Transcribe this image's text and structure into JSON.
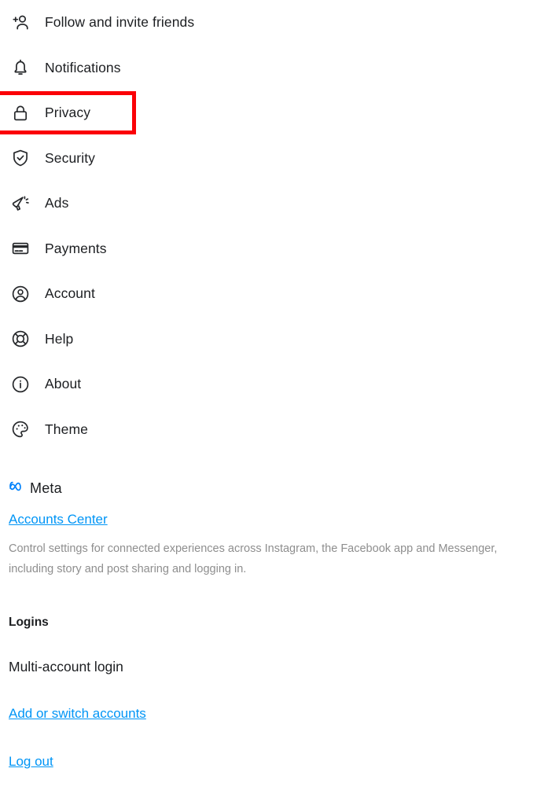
{
  "menu": {
    "items": [
      {
        "label": "Follow and invite friends",
        "icon": "person-add-icon",
        "highlighted": false
      },
      {
        "label": "Notifications",
        "icon": "bell-icon",
        "highlighted": false
      },
      {
        "label": "Privacy",
        "icon": "lock-icon",
        "highlighted": true
      },
      {
        "label": "Security",
        "icon": "shield-check-icon",
        "highlighted": false
      },
      {
        "label": "Ads",
        "icon": "megaphone-icon",
        "highlighted": false
      },
      {
        "label": "Payments",
        "icon": "credit-card-icon",
        "highlighted": false
      },
      {
        "label": "Account",
        "icon": "user-circle-icon",
        "highlighted": false
      },
      {
        "label": "Help",
        "icon": "lifebuoy-icon",
        "highlighted": false
      },
      {
        "label": "About",
        "icon": "info-circle-icon",
        "highlighted": false
      },
      {
        "label": "Theme",
        "icon": "palette-icon",
        "highlighted": false
      }
    ]
  },
  "meta_section": {
    "logo_icon": "meta-infinity-icon",
    "brand": "Meta",
    "accounts_center_label": "Accounts Center",
    "description": "Control settings for connected experiences across Instagram, the Facebook app and Messenger, including story and post sharing and logging in."
  },
  "logins_section": {
    "heading": "Logins",
    "multi_account_label": "Multi-account login",
    "add_switch_label": "Add or switch accounts",
    "log_out_label": "Log out"
  },
  "colors": {
    "link_blue": "#0095F6",
    "meta_blue": "#0081FB",
    "text_primary": "#1C1E21",
    "text_muted": "#8E8E8E",
    "highlight_red": "#FB0007",
    "background": "#FFFFFF"
  }
}
